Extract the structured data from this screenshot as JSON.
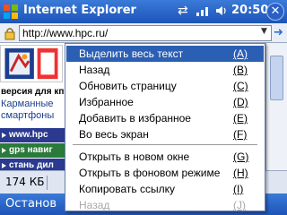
{
  "titlebar": {
    "title": "Internet Explorer",
    "time": "20:50",
    "close_label": "✕"
  },
  "address": {
    "url": "http://www.hpc.ru/"
  },
  "webpage": {
    "tagline": "версия для кп",
    "description": "Карманные смартфоны",
    "nav_links": [
      "www.hpc",
      "gps навиг",
      "стань дил"
    ]
  },
  "context_menu": {
    "items": [
      {
        "label": "Выделить весь текст",
        "key": "(A)"
      },
      {
        "label": "Назад",
        "key": "(B)"
      },
      {
        "label": "Обновить страницу",
        "key": "(C)"
      },
      {
        "label": "Избранное",
        "key": "(D)"
      },
      {
        "label": "Добавить в избранное",
        "key": "(E)"
      },
      {
        "label": "Во весь экран",
        "key": "(F)"
      },
      {
        "label": "Открыть в новом окне",
        "key": "(G)"
      },
      {
        "label": "Открыть в фоновом режиме",
        "key": "(H)"
      },
      {
        "label": "Копировать ссылку",
        "key": "(I)"
      },
      {
        "label": "Назад",
        "key": "(J)"
      }
    ]
  },
  "statusbar": {
    "size": "174 КБ"
  },
  "commandbar": {
    "left_label": "Останов"
  },
  "colors": {
    "title_bar": "#1c54b8",
    "menu_highlight": "#2b5fb4",
    "disabled_text": "#a8a8a8"
  }
}
